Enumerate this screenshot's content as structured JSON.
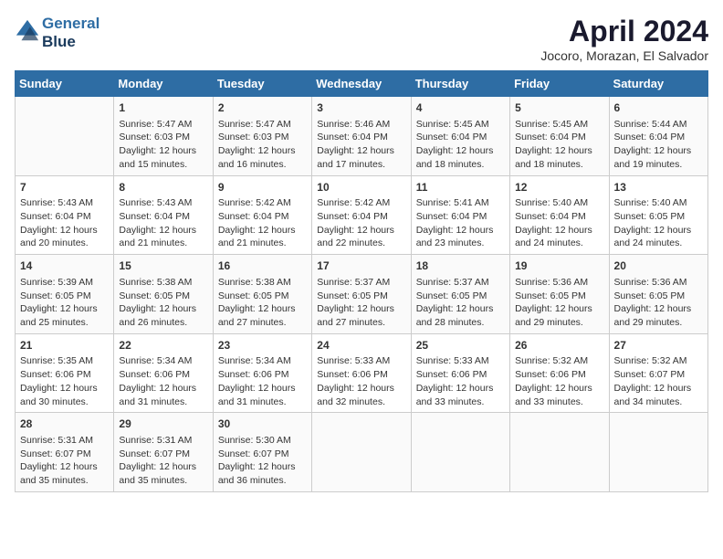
{
  "header": {
    "logo_line1": "General",
    "logo_line2": "Blue",
    "month_year": "April 2024",
    "location": "Jocoro, Morazan, El Salvador"
  },
  "days_of_week": [
    "Sunday",
    "Monday",
    "Tuesday",
    "Wednesday",
    "Thursday",
    "Friday",
    "Saturday"
  ],
  "weeks": [
    [
      {
        "day": null,
        "sunrise": null,
        "sunset": null,
        "daylight": null
      },
      {
        "day": "1",
        "sunrise": "Sunrise: 5:47 AM",
        "sunset": "Sunset: 6:03 PM",
        "daylight": "Daylight: 12 hours and 15 minutes."
      },
      {
        "day": "2",
        "sunrise": "Sunrise: 5:47 AM",
        "sunset": "Sunset: 6:03 PM",
        "daylight": "Daylight: 12 hours and 16 minutes."
      },
      {
        "day": "3",
        "sunrise": "Sunrise: 5:46 AM",
        "sunset": "Sunset: 6:04 PM",
        "daylight": "Daylight: 12 hours and 17 minutes."
      },
      {
        "day": "4",
        "sunrise": "Sunrise: 5:45 AM",
        "sunset": "Sunset: 6:04 PM",
        "daylight": "Daylight: 12 hours and 18 minutes."
      },
      {
        "day": "5",
        "sunrise": "Sunrise: 5:45 AM",
        "sunset": "Sunset: 6:04 PM",
        "daylight": "Daylight: 12 hours and 18 minutes."
      },
      {
        "day": "6",
        "sunrise": "Sunrise: 5:44 AM",
        "sunset": "Sunset: 6:04 PM",
        "daylight": "Daylight: 12 hours and 19 minutes."
      }
    ],
    [
      {
        "day": "7",
        "sunrise": "Sunrise: 5:43 AM",
        "sunset": "Sunset: 6:04 PM",
        "daylight": "Daylight: 12 hours and 20 minutes."
      },
      {
        "day": "8",
        "sunrise": "Sunrise: 5:43 AM",
        "sunset": "Sunset: 6:04 PM",
        "daylight": "Daylight: 12 hours and 21 minutes."
      },
      {
        "day": "9",
        "sunrise": "Sunrise: 5:42 AM",
        "sunset": "Sunset: 6:04 PM",
        "daylight": "Daylight: 12 hours and 21 minutes."
      },
      {
        "day": "10",
        "sunrise": "Sunrise: 5:42 AM",
        "sunset": "Sunset: 6:04 PM",
        "daylight": "Daylight: 12 hours and 22 minutes."
      },
      {
        "day": "11",
        "sunrise": "Sunrise: 5:41 AM",
        "sunset": "Sunset: 6:04 PM",
        "daylight": "Daylight: 12 hours and 23 minutes."
      },
      {
        "day": "12",
        "sunrise": "Sunrise: 5:40 AM",
        "sunset": "Sunset: 6:04 PM",
        "daylight": "Daylight: 12 hours and 24 minutes."
      },
      {
        "day": "13",
        "sunrise": "Sunrise: 5:40 AM",
        "sunset": "Sunset: 6:05 PM",
        "daylight": "Daylight: 12 hours and 24 minutes."
      }
    ],
    [
      {
        "day": "14",
        "sunrise": "Sunrise: 5:39 AM",
        "sunset": "Sunset: 6:05 PM",
        "daylight": "Daylight: 12 hours and 25 minutes."
      },
      {
        "day": "15",
        "sunrise": "Sunrise: 5:38 AM",
        "sunset": "Sunset: 6:05 PM",
        "daylight": "Daylight: 12 hours and 26 minutes."
      },
      {
        "day": "16",
        "sunrise": "Sunrise: 5:38 AM",
        "sunset": "Sunset: 6:05 PM",
        "daylight": "Daylight: 12 hours and 27 minutes."
      },
      {
        "day": "17",
        "sunrise": "Sunrise: 5:37 AM",
        "sunset": "Sunset: 6:05 PM",
        "daylight": "Daylight: 12 hours and 27 minutes."
      },
      {
        "day": "18",
        "sunrise": "Sunrise: 5:37 AM",
        "sunset": "Sunset: 6:05 PM",
        "daylight": "Daylight: 12 hours and 28 minutes."
      },
      {
        "day": "19",
        "sunrise": "Sunrise: 5:36 AM",
        "sunset": "Sunset: 6:05 PM",
        "daylight": "Daylight: 12 hours and 29 minutes."
      },
      {
        "day": "20",
        "sunrise": "Sunrise: 5:36 AM",
        "sunset": "Sunset: 6:05 PM",
        "daylight": "Daylight: 12 hours and 29 minutes."
      }
    ],
    [
      {
        "day": "21",
        "sunrise": "Sunrise: 5:35 AM",
        "sunset": "Sunset: 6:06 PM",
        "daylight": "Daylight: 12 hours and 30 minutes."
      },
      {
        "day": "22",
        "sunrise": "Sunrise: 5:34 AM",
        "sunset": "Sunset: 6:06 PM",
        "daylight": "Daylight: 12 hours and 31 minutes."
      },
      {
        "day": "23",
        "sunrise": "Sunrise: 5:34 AM",
        "sunset": "Sunset: 6:06 PM",
        "daylight": "Daylight: 12 hours and 31 minutes."
      },
      {
        "day": "24",
        "sunrise": "Sunrise: 5:33 AM",
        "sunset": "Sunset: 6:06 PM",
        "daylight": "Daylight: 12 hours and 32 minutes."
      },
      {
        "day": "25",
        "sunrise": "Sunrise: 5:33 AM",
        "sunset": "Sunset: 6:06 PM",
        "daylight": "Daylight: 12 hours and 33 minutes."
      },
      {
        "day": "26",
        "sunrise": "Sunrise: 5:32 AM",
        "sunset": "Sunset: 6:06 PM",
        "daylight": "Daylight: 12 hours and 33 minutes."
      },
      {
        "day": "27",
        "sunrise": "Sunrise: 5:32 AM",
        "sunset": "Sunset: 6:07 PM",
        "daylight": "Daylight: 12 hours and 34 minutes."
      }
    ],
    [
      {
        "day": "28",
        "sunrise": "Sunrise: 5:31 AM",
        "sunset": "Sunset: 6:07 PM",
        "daylight": "Daylight: 12 hours and 35 minutes."
      },
      {
        "day": "29",
        "sunrise": "Sunrise: 5:31 AM",
        "sunset": "Sunset: 6:07 PM",
        "daylight": "Daylight: 12 hours and 35 minutes."
      },
      {
        "day": "30",
        "sunrise": "Sunrise: 5:30 AM",
        "sunset": "Sunset: 6:07 PM",
        "daylight": "Daylight: 12 hours and 36 minutes."
      },
      {
        "day": null,
        "sunrise": null,
        "sunset": null,
        "daylight": null
      },
      {
        "day": null,
        "sunrise": null,
        "sunset": null,
        "daylight": null
      },
      {
        "day": null,
        "sunrise": null,
        "sunset": null,
        "daylight": null
      },
      {
        "day": null,
        "sunrise": null,
        "sunset": null,
        "daylight": null
      }
    ]
  ]
}
